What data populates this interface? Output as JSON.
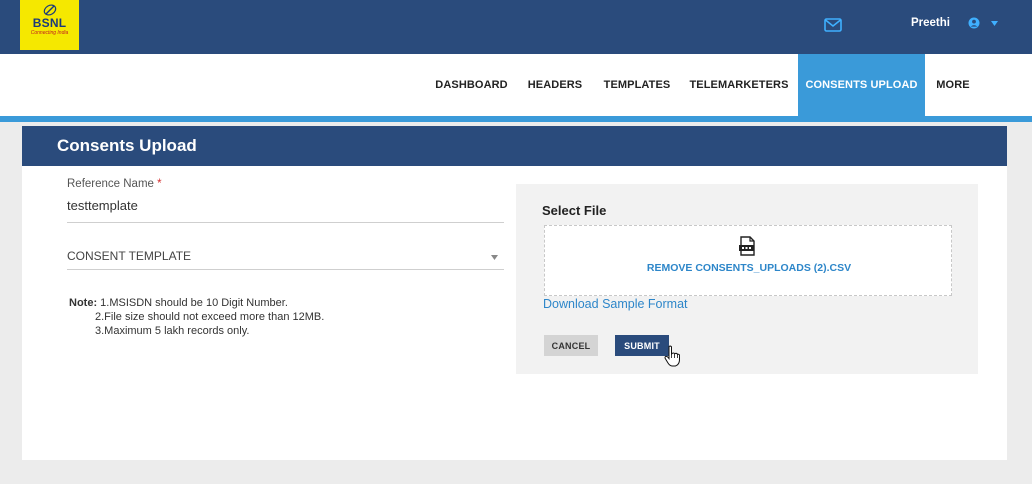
{
  "header": {
    "logo_text": "BSNL",
    "logo_tagline": "Connecting India",
    "user_name": "Preethi",
    "icons": [
      "mail-icon",
      "user-icon",
      "chevron-down-icon"
    ]
  },
  "nav": {
    "items": [
      {
        "label": "DASHBOARD"
      },
      {
        "label": "HEADERS"
      },
      {
        "label": "TEMPLATES"
      },
      {
        "label": "TELEMARKETERS"
      },
      {
        "label": "CONSENTS UPLOAD"
      },
      {
        "label": "MORE"
      }
    ],
    "active": "CONSENTS UPLOAD"
  },
  "page": {
    "title": "Consents Upload"
  },
  "form": {
    "ref_label": "Reference Name",
    "required_mark": "*",
    "ref_value": "testtemplate",
    "template_value": "CONSENT TEMPLATE",
    "note_label": "Note:",
    "note_1": "1.MSISDN should be 10 Digit Number.",
    "note_2": "2.File size should not exceed more than 12MB.",
    "note_3": "3.Maximum 5 lakh records only."
  },
  "upload": {
    "title": "Select File",
    "file_action": "REMOVE CONSENTS_UPLOADS (2).CSV",
    "sample_link": "Download Sample Format",
    "cancel_label": "CANCEL",
    "submit_label": "SUBMIT"
  },
  "colors": {
    "header_bg": "#2a4b7c",
    "accent": "#3a9ad9",
    "logo_bg": "#f5e800",
    "link": "#2d86c9"
  }
}
